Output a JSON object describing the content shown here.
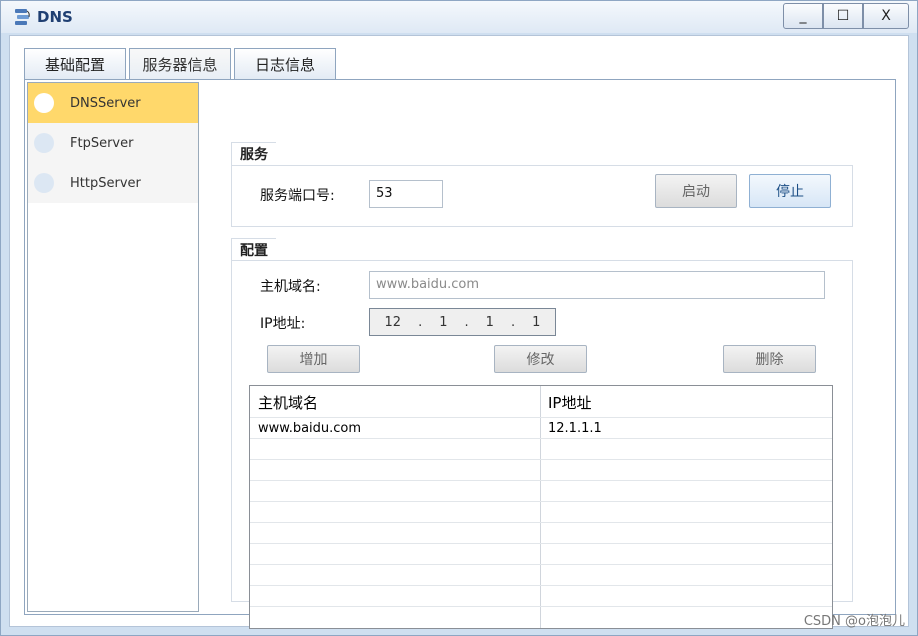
{
  "window": {
    "title": "DNS"
  },
  "window_controls": {
    "minimize": "_",
    "maximize": "☐",
    "close": "X"
  },
  "tabs": [
    {
      "label": "基础配置"
    },
    {
      "label": "服务器信息"
    },
    {
      "label": "日志信息"
    }
  ],
  "sidebar": {
    "items": [
      {
        "label": "DNSServer",
        "active": true
      },
      {
        "label": "FtpServer",
        "active": false
      },
      {
        "label": "HttpServer",
        "active": false
      }
    ]
  },
  "service": {
    "group_title": "服务",
    "port_label": "服务端口号:",
    "port_value": "53",
    "start_label": "启动",
    "stop_label": "停止"
  },
  "config": {
    "group_title": "配置",
    "hostname_label": "主机域名:",
    "hostname_placeholder": "www.baidu.com",
    "ip_label": "IP地址:",
    "ip_octets": [
      "12",
      "1",
      "1",
      "1"
    ],
    "add_label": "增加",
    "modify_label": "修改",
    "delete_label": "删除"
  },
  "table": {
    "columns": [
      "主机域名",
      "IP地址"
    ],
    "rows": [
      [
        "www.baidu.com",
        "12.1.1.1"
      ]
    ]
  },
  "watermark": "CSDN @o泡泡儿",
  "colors": {
    "active_item": "#ffd86b",
    "accent": "#1d4f86"
  }
}
